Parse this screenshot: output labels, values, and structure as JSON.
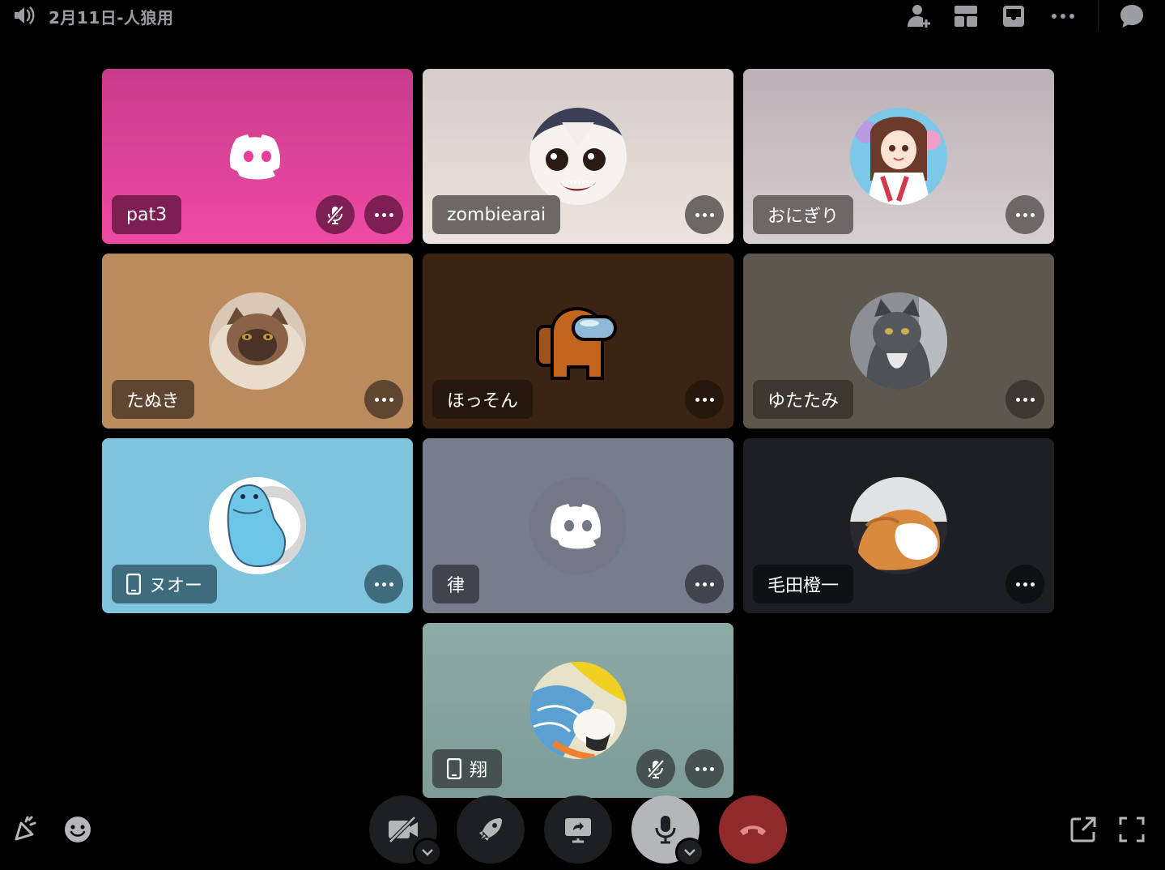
{
  "header": {
    "channel_name": "2月11日-人狼用",
    "icons": [
      "speaker-icon",
      "add-member-icon",
      "layout-grid-icon",
      "inbox-icon",
      "more-options-icon",
      "chat-icon"
    ]
  },
  "participants": [
    {
      "name": "pat3",
      "muted": true,
      "mobile": false,
      "avatar": "discord-logo",
      "bg": "#e6409a"
    },
    {
      "name": "zombiearai",
      "muted": false,
      "mobile": false,
      "avatar": "anime-zombie-girl",
      "bg": "#e2d6d2"
    },
    {
      "name": "おにぎり",
      "muted": false,
      "mobile": false,
      "avatar": "anime-girl-kimono",
      "bg": "#c9bfc3"
    },
    {
      "name": "たぬき",
      "muted": false,
      "mobile": false,
      "avatar": "himalayan-cat",
      "bg": "#b98b5d"
    },
    {
      "name": "ほっそん",
      "muted": false,
      "mobile": false,
      "avatar": "among-us-crewmate-orange",
      "bg": "#3b2413"
    },
    {
      "name": "ゆたたみ",
      "muted": false,
      "mobile": false,
      "avatar": "grey-longhair-cat",
      "bg": "#5e574d"
    },
    {
      "name": "ヌオー",
      "muted": false,
      "mobile": true,
      "avatar": "quagsire",
      "bg": "#7fc3dc"
    },
    {
      "name": "律",
      "muted": false,
      "mobile": false,
      "avatar": "discord-logo",
      "bg": "#777d8a"
    },
    {
      "name": "毛田橙一",
      "muted": false,
      "mobile": false,
      "avatar": "orange-white-cat",
      "bg": "#1e1f23"
    },
    {
      "name": "翔",
      "muted": true,
      "mobile": true,
      "avatar": "parrot-painting",
      "bg": "#8aaaa4"
    }
  ],
  "controls": {
    "left": [
      "soundboard-icon",
      "emoji-icon"
    ],
    "center": [
      "camera-off",
      "activities",
      "screen-share",
      "microphone",
      "disconnect"
    ],
    "right": [
      "popout-icon",
      "fullscreen-icon"
    ],
    "disconnect_color": "#8e2a2a",
    "mic_bg": "#b5b6b8"
  }
}
